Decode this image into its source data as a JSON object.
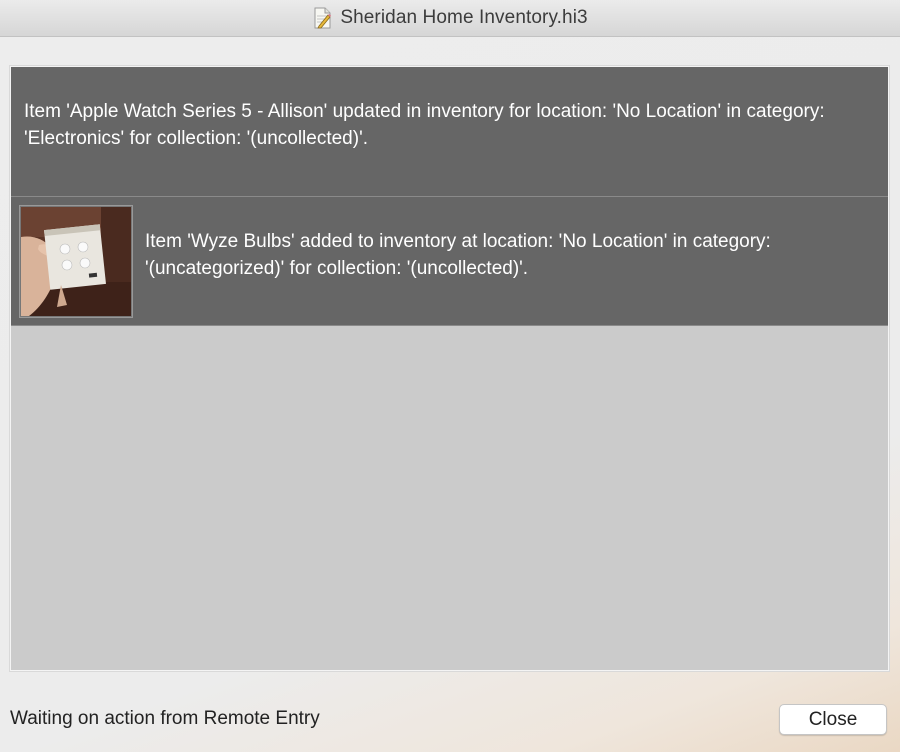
{
  "window": {
    "title": "Sheridan Home Inventory.hi3",
    "title_icon": "document-icon"
  },
  "entries": [
    {
      "message": "Item 'Apple Watch Series 5 - Allison' updated in inventory for location: 'No Location' in category: 'Electronics' for collection: '(uncollected)'.",
      "has_thumbnail": false
    },
    {
      "message": "Item 'Wyze Bulbs' added to inventory at location: 'No Location' in category: '(uncategorized)' for collection: '(uncollected)'.",
      "has_thumbnail": true,
      "thumbnail": "photo of a hand holding a Wyze bulb box"
    }
  ],
  "status": {
    "text": "Waiting on action from Remote Entry"
  },
  "buttons": {
    "close_label": "Close"
  },
  "colors": {
    "entry_background": "#666666",
    "list_background": "#cbcbcb",
    "entry_text": "#ffffff"
  }
}
